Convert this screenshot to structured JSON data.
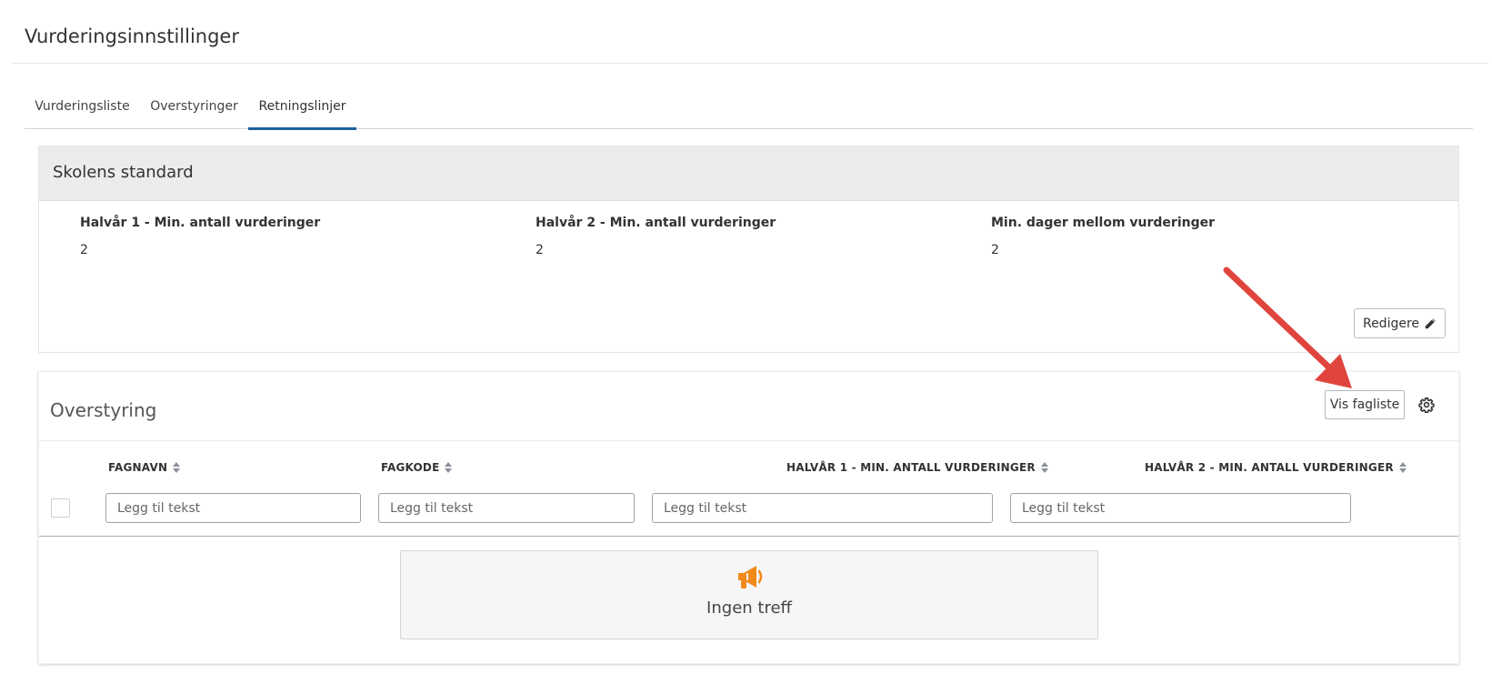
{
  "page": {
    "title": "Vurderingsinnstillinger"
  },
  "tabs": [
    {
      "label": "Vurderingsliste",
      "active": false
    },
    {
      "label": "Overstyringer",
      "active": false
    },
    {
      "label": "Retningslinjer",
      "active": true
    }
  ],
  "standard": {
    "header": "Skolens standard",
    "fields": [
      {
        "label": "Halvår 1 - Min. antall vurderinger",
        "value": "2"
      },
      {
        "label": "Halvår 2 - Min. antall vurderinger",
        "value": "2"
      },
      {
        "label": "Min. dager mellom vurderinger",
        "value": "2"
      }
    ],
    "edit_label": "Redigere"
  },
  "overstyring": {
    "title": "Overstyring",
    "show_list_label": "Vis fagliste",
    "columns": [
      {
        "label": "FAGNAVN"
      },
      {
        "label": "FAGKODE"
      },
      {
        "label": "HALVÅR 1 - MIN. ANTALL VURDERINGER"
      },
      {
        "label": "HALVÅR 2 - MIN. ANTALL VURDERINGER"
      }
    ],
    "filter_placeholder": "Legg til tekst",
    "empty_text": "Ingen treff"
  },
  "colors": {
    "accent": "#1f5f9e",
    "empty_icon": "#f28a1b",
    "annotation_arrow": "#e0453d"
  },
  "icons": [
    "pencil-icon",
    "gear-icon",
    "sort-icon",
    "megaphone-icon"
  ]
}
